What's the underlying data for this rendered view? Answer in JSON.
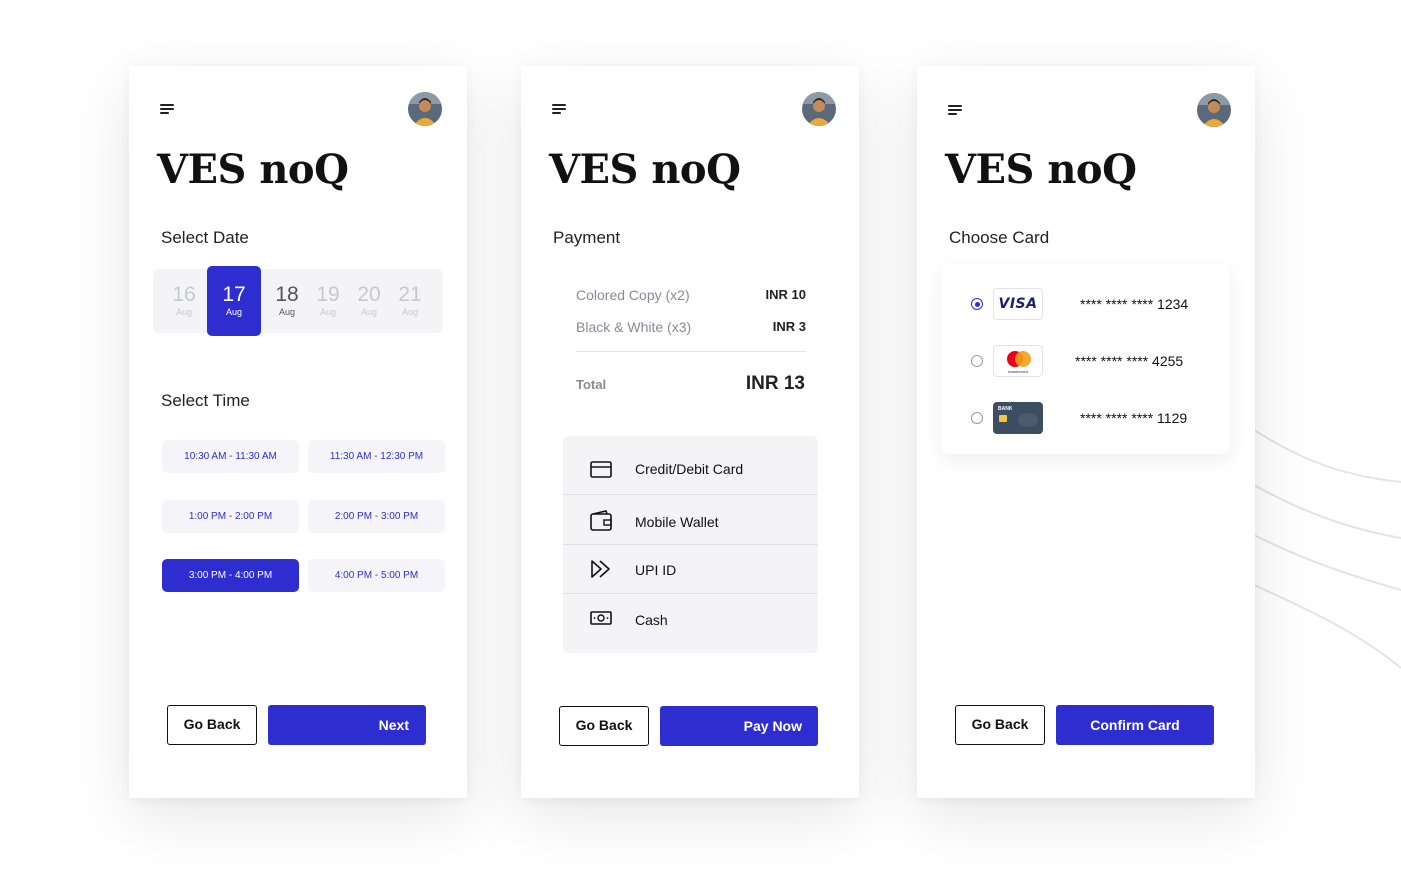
{
  "app_title": "VES noQ",
  "screen1": {
    "select_date_label": "Select Date",
    "dates": [
      {
        "day": "16",
        "month": "Aug"
      },
      {
        "day": "17",
        "month": "Aug",
        "selected": true
      },
      {
        "day": "18",
        "month": "Aug"
      },
      {
        "day": "19",
        "month": "Aug"
      },
      {
        "day": "20",
        "month": "Aug"
      },
      {
        "day": "21",
        "month": "Aug"
      }
    ],
    "select_time_label": "Select Time",
    "time_slots": [
      "10:30 AM - 11:30 AM",
      "11:30 AM - 12:30 PM",
      "1:00 PM - 2:00 PM",
      "2:00 PM - 3:00 PM",
      "3:00 PM - 4:00 PM",
      "4:00 PM - 5:00 PM"
    ],
    "selected_time_slot": "3:00 PM - 4:00 PM",
    "back_label": "Go Back",
    "next_label": "Next"
  },
  "screen2": {
    "payment_label": "Payment",
    "items": [
      {
        "label": "Colored Copy (x2)",
        "amount": "INR 10"
      },
      {
        "label": "Black & White (x3)",
        "amount": "INR 3"
      }
    ],
    "total_label": "Total",
    "total_value": "INR 13",
    "methods": [
      {
        "label": "Credit/Debit Card",
        "icon": "credit-card-icon"
      },
      {
        "label": "Mobile Wallet",
        "icon": "wallet-icon"
      },
      {
        "label": "UPI ID",
        "icon": "upi-icon"
      },
      {
        "label": "Cash",
        "icon": "cash-icon"
      }
    ],
    "back_label": "Go Back",
    "pay_label": "Pay Now"
  },
  "screen3": {
    "choose_card_label": "Choose Card",
    "cards": [
      {
        "brand": "visa",
        "logo_text": "VISA",
        "number": "**** **** **** 1234",
        "selected": true
      },
      {
        "brand": "mastercard",
        "logo_text": "mastercard",
        "number": "**** **** **** 4255",
        "selected": false
      },
      {
        "brand": "bank",
        "logo_text": "BANK",
        "number": "**** **** **** 1129",
        "selected": false
      }
    ],
    "back_label": "Go Back",
    "confirm_label": "Confirm Card"
  },
  "colors": {
    "accent": "#2e2ed0",
    "muted_text": "#8a8a95",
    "chip_bg": "#f4f4f7"
  }
}
